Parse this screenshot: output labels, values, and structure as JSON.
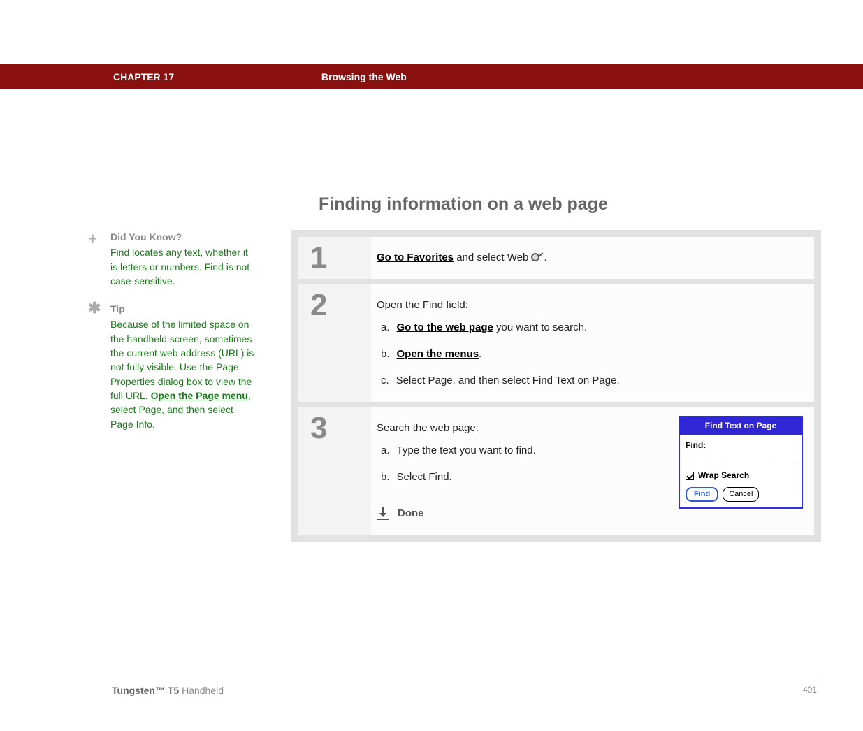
{
  "header": {
    "chapter": "CHAPTER 17",
    "title": "Browsing the Web"
  },
  "section_title": "Finding information on a web page",
  "sidebar": {
    "dyk": {
      "head": "Did You Know?",
      "body": "Find locates any text, whether it is letters or numbers. Find is not case-sensitive."
    },
    "tip": {
      "head": "Tip",
      "body_pre": "Because of the limited space on the handheld screen, sometimes the current web address (URL) is not fully visible. Use the Page Properties dialog box to view the full URL. ",
      "link": "Open the Page menu",
      "body_post": ", select Page, and then select Page Info."
    }
  },
  "steps": [
    {
      "num": "1",
      "link": "Go to Favorites",
      "trail": " and select Web ",
      "period": "."
    },
    {
      "num": "2",
      "intro": "Open the Find field:",
      "items": [
        {
          "letter": "a.",
          "link": "Go to the web page",
          "trail": " you want to search."
        },
        {
          "letter": "b.",
          "link": "Open the menus",
          "trail": "."
        },
        {
          "letter": "c.",
          "plain": "Select Page, and then select Find Text on Page."
        }
      ]
    },
    {
      "num": "3",
      "intro": "Search the web page:",
      "items": [
        {
          "letter": "a.",
          "plain": "Type the text you want to find."
        },
        {
          "letter": "b.",
          "plain": "Select Find."
        }
      ],
      "done": "Done",
      "dialog": {
        "title": "Find Text on Page",
        "label": "Find:",
        "wrap": "Wrap Search",
        "find_btn": "Find",
        "cancel_btn": "Cancel"
      }
    }
  ],
  "footer": {
    "product_bold": "Tungsten™ T5",
    "product_rest": " Handheld",
    "page": "401"
  }
}
